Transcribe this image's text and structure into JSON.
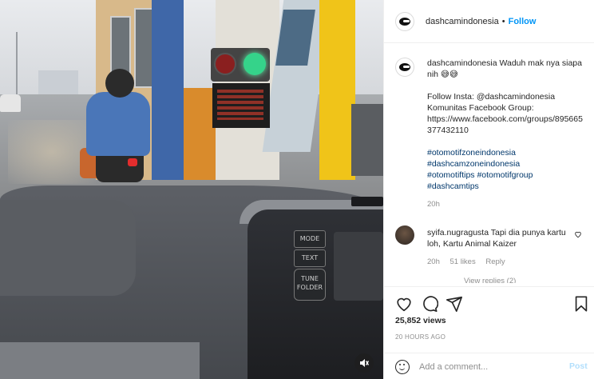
{
  "post": {
    "author": "dashcamindonesia",
    "header_separator": "•",
    "follow_label": "Follow",
    "caption": {
      "username": "dashcamindonesia",
      "lines": [
        "Waduh mak nya siapa nih 😅😅",
        "",
        "Follow Insta: @dashcamindonesia",
        "Komunitas Facebook Group:",
        "https://www.facebook.com/groups/895665377432110",
        ""
      ],
      "hashtags": [
        "#otomotifzoneindonesia",
        "#dashcamzoneindonesia",
        "#otomotiftips #otomotifgroup",
        "#dashcamtips"
      ],
      "time": "20h"
    },
    "comments": [
      {
        "username": "syifa.nugragusta",
        "text": "Tapi dia punya kartu loh, Kartu Animal Kaizer",
        "time": "20h",
        "likes": "51 likes",
        "reply_label": "Reply",
        "view_replies": "View replies (2)"
      }
    ],
    "views": "25,852 views",
    "posted_ago": "20 HOURS AGO",
    "add_comment_placeholder": "Add a comment...",
    "post_label": "Post"
  },
  "video": {
    "console_buttons": [
      "MODE",
      "TEXT",
      "TUNE FOLDER"
    ],
    "mute_icon": "speaker-muted-icon"
  },
  "colors": {
    "follow": "#0095f6",
    "post_disabled": "#b2dffc",
    "hashtag": "#00376b",
    "muted_text": "#8e8e8e"
  }
}
